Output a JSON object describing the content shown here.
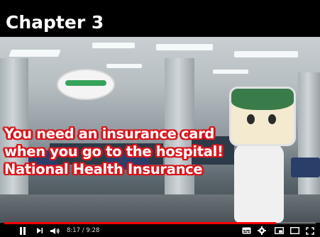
{
  "chapter": {
    "title": "Chapter 3"
  },
  "caption": {
    "lines": [
      "You need an insurance card",
      "when you go to the hospital!",
      "National Health Insurance"
    ],
    "fill_color": "#ffffff",
    "outline_color": "#d8141a"
  },
  "player": {
    "time": "8:17 / 9:28",
    "progress": 0.873,
    "progress_color": "#ff0000",
    "icons": {
      "play_pause": "pause-icon",
      "next": "next-icon",
      "volume": "volume-icon",
      "subtitles": "subtitles-icon",
      "settings": "gear-icon",
      "miniplayer": "miniplayer-icon",
      "theater": "theater-icon",
      "fullscreen": "fullscreen-icon"
    }
  }
}
